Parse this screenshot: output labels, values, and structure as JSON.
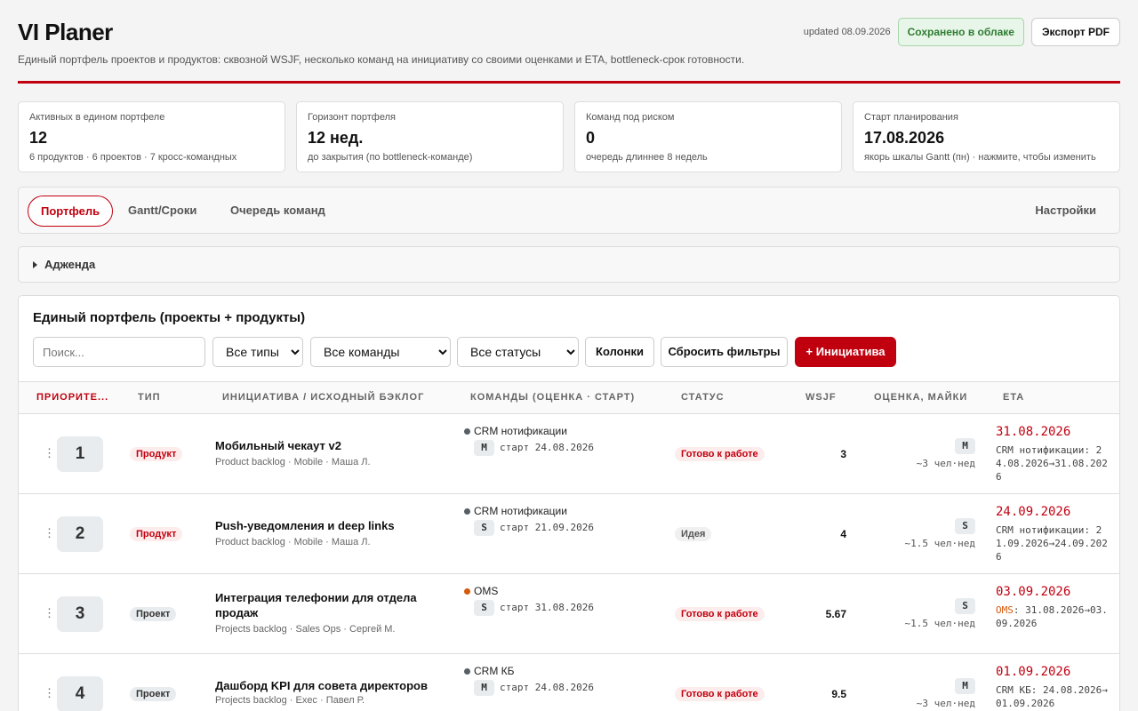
{
  "header": {
    "title": "VI Planer",
    "subtitle": "Единый портфель проектов и продуктов: сквозной WSJF, несколько команд на инициативу со своими оценками и ETA, bottleneck-срок готовности.",
    "updated": "updated 08.09.2026",
    "saved_label": "Сохранено в облаке",
    "export_label": "Экспорт PDF"
  },
  "kpis": [
    {
      "label": "Активных в едином портфеле",
      "value": "12",
      "note": "6 продуктов · 6 проектов · 7 кросс-командных"
    },
    {
      "label": "Горизонт портфеля",
      "value": "12 нед.",
      "note": "до закрытия (по bottleneck-команде)"
    },
    {
      "label": "Команд под риском",
      "value": "0",
      "note": "очередь длиннее 8 недель"
    },
    {
      "label": "Старт планирования",
      "value": "17.08.2026",
      "note": "якорь шкалы Gantt (пн) · нажмите, чтобы изменить"
    }
  ],
  "tabs": {
    "portfolio": "Портфель",
    "gantt": "Gantt/Сроки",
    "queue": "Очередь команд",
    "settings": "Настройки"
  },
  "agenda": {
    "label": "Адженда"
  },
  "portfolio": {
    "title": "Единый портфель (проекты + продукты)",
    "search_placeholder": "Поиск...",
    "type_filter": "Все типы",
    "team_filter": "Все команды",
    "status_filter": "Все статусы",
    "columns_label": "Колонки",
    "reset_label": "Сбросить фильтры",
    "add_label": "+ Инициатива"
  },
  "columns": {
    "priority": "ПРИОРИТЕ...",
    "type": "ТИП",
    "initiative": "ИНИЦИАТИВА / ИСХОДНЫЙ БЭКЛОГ",
    "teams": "КОМАНДЫ (ОЦЕНКА · СТАРТ)",
    "status": "СТАТУС",
    "wsjf": "WSJF",
    "estimate": "ОЦЕНКА, МАЙКИ",
    "eta": "ETA"
  },
  "colors": {
    "accent": "#c0000f",
    "team_gray": "#555f66",
    "team_orange": "#d55a0c"
  },
  "rows": [
    {
      "rank": "1",
      "type": "Продукт",
      "title": "Мобильный чекаут v2",
      "meta": "Product backlog · Mobile · Маша Л.",
      "team": "CRM нотификации",
      "team_color": "#555f66",
      "size": "M",
      "start": "старт 24.08.2026",
      "status": "Готово к работе",
      "wsjf": "3",
      "est_size": "M",
      "est_note": "~3 чел·нед",
      "eta": "31.08.2026",
      "eta_team": "CRM нотификации",
      "eta_range": "24.08.2026→31.08.2026"
    },
    {
      "rank": "2",
      "type": "Продукт",
      "title": "Push-уведомления и deep links",
      "meta": "Product backlog · Mobile · Маша Л.",
      "team": "CRM нотификации",
      "team_color": "#555f66",
      "size": "S",
      "start": "старт 21.09.2026",
      "status": "Идея",
      "wsjf": "4",
      "est_size": "S",
      "est_note": "~1.5 чел·нед",
      "eta": "24.09.2026",
      "eta_team": "CRM нотификации",
      "eta_range": "21.09.2026→24.09.2026"
    },
    {
      "rank": "3",
      "type": "Проект",
      "title": "Интеграция телефонии для отдела продаж",
      "meta": "Projects backlog · Sales Ops · Сергей М.",
      "team": "OMS",
      "team_color": "#d55a0c",
      "size": "S",
      "start": "старт 31.08.2026",
      "status": "Готово к работе",
      "wsjf": "5.67",
      "est_size": "S",
      "est_note": "~1.5 чел·нед",
      "eta": "03.09.2026",
      "eta_team": "OMS",
      "eta_range": "31.08.2026→03.09.2026"
    },
    {
      "rank": "4",
      "type": "Проект",
      "title": "Дашборд KPI для совета директоров",
      "meta": "Projects backlog · Exec · Павел Р.",
      "team": "CRM КБ",
      "team_color": "#555f66",
      "size": "M",
      "start": "старт 24.08.2026",
      "status": "Готово к работе",
      "wsjf": "9.5",
      "est_size": "M",
      "est_note": "~3 чел·нед",
      "eta": "01.09.2026",
      "eta_team": "CRM КБ",
      "eta_range": "24.08.2026→01.09.2026"
    }
  ]
}
